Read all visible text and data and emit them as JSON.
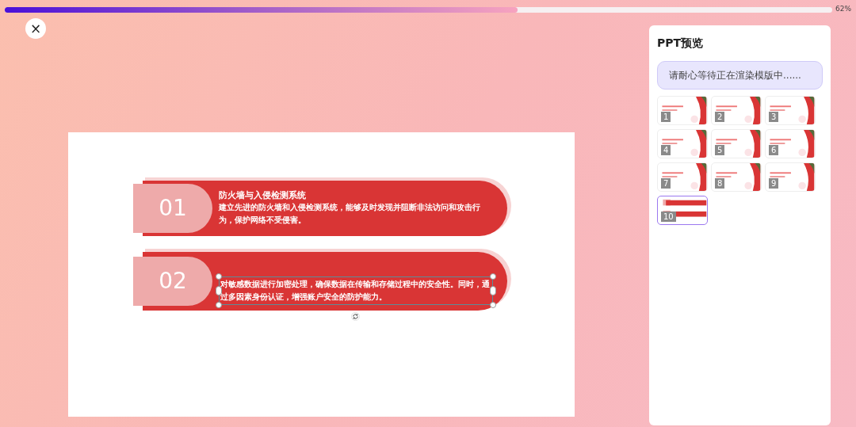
{
  "progress": {
    "level": 0.62,
    "reading": "62%"
  },
  "close_button": {
    "label": "×"
  },
  "slide": {
    "items": [
      {
        "number": "01",
        "title": "防火墙与入侵检测系统",
        "body": "建立先进的防火墙和入侵检测系统，能够及时发现并阻断非法访问和攻击行为，保护网络不受侵害。",
        "selected": false
      },
      {
        "number": "02",
        "body": "对敏感数据进行加密处理，确保数据在传输和存储过程中的安全性。同时，通过多因素身份认证，增强账户安全的防护能力。",
        "selected": true
      }
    ]
  },
  "preview": {
    "title": "PPT预览",
    "notice": "请耐心等待正在渲染模版中......",
    "thumbnails": [
      {
        "number": "1",
        "selected": false
      },
      {
        "number": "2",
        "selected": false
      },
      {
        "number": "3",
        "selected": false
      },
      {
        "number": "4",
        "selected": false
      },
      {
        "number": "5",
        "selected": false
      },
      {
        "number": "6",
        "selected": false
      },
      {
        "number": "7",
        "selected": false
      },
      {
        "number": "8",
        "selected": false
      },
      {
        "number": "9",
        "selected": false
      },
      {
        "number": "10",
        "selected": true
      }
    ]
  }
}
